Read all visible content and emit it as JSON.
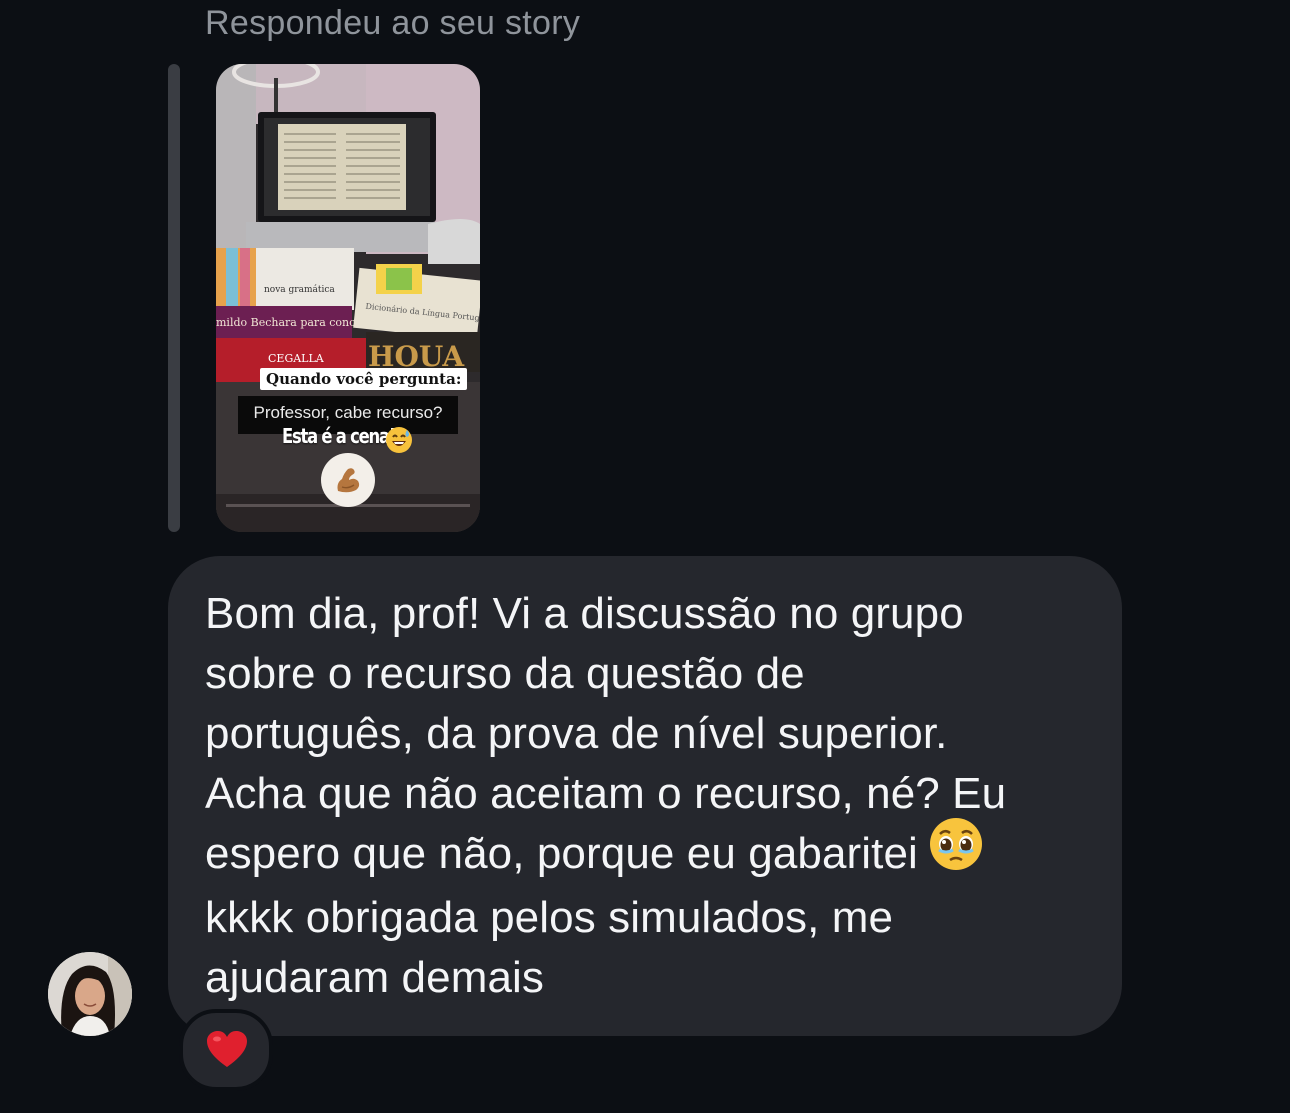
{
  "conversation": {
    "reply_header": "Respondeu ao seu story",
    "story": {
      "sticker_question_title": "Quando você pergunta:",
      "sticker_question_text": "Professor, cabe recurso?",
      "sticker_caption": "Esta é a cena!",
      "caption_emoji": "grinning-sweat-emoji",
      "reaction_emoji": "flexed-biceps-emoji",
      "book_labels": [
        "nova gramática",
        "mildo Bechara para concursos",
        "CEGALLA",
        "HOUA",
        "Dicionário da Língua Portugu"
      ]
    },
    "message": {
      "lines": [
        "Bom dia, prof! Vi a discussão no grupo",
        "sobre o recurso da questão de",
        "português, da prova de nível superior.",
        "Acha que não aceitam o recurso, né? Eu",
        "espero que não, porque eu gabaritei",
        "kkkk obrigada pelos simulados, me",
        "ajudaram demais"
      ],
      "inline_emoji": "pleading-face-emoji"
    },
    "reaction": "red-heart-icon",
    "colors": {
      "background": "#0c0f14",
      "bubble": "#25272d",
      "text": "#f4f5f7",
      "muted": "#8f949b",
      "heart": "#e0202e"
    }
  }
}
